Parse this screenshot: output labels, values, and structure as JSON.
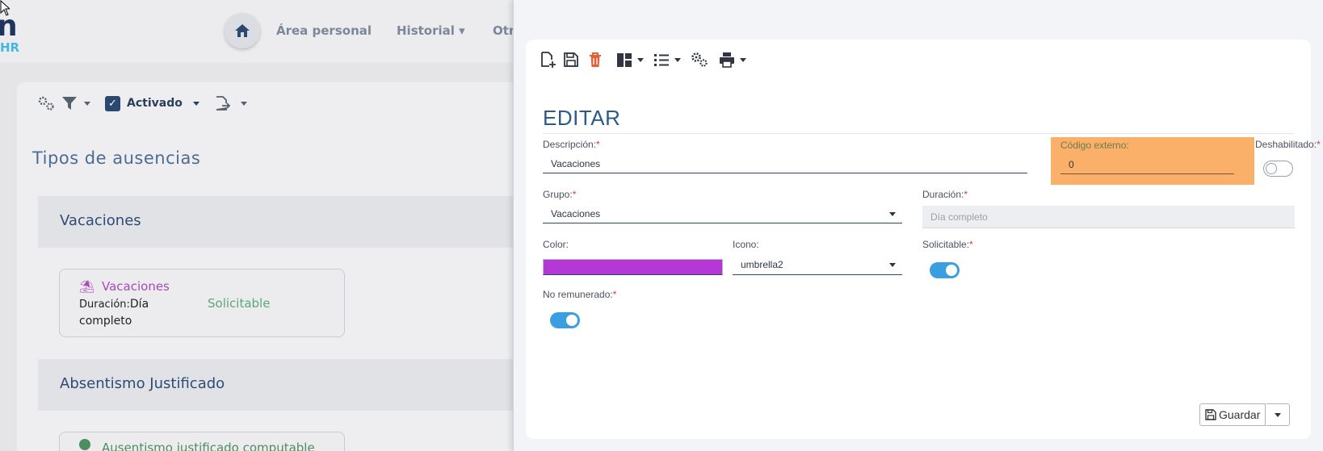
{
  "background": {
    "logo": {
      "letter": "n",
      "sub": "HR"
    },
    "nav": {
      "area_personal": "Área personal",
      "historial": "Historial ▾",
      "otros": "Otr"
    },
    "toolbar": {
      "activado": "Activado"
    },
    "page_title": "Tipos de ausencias",
    "groups": [
      {
        "title": "Vacaciones"
      },
      {
        "title": "Absentismo Justificado"
      }
    ],
    "card": {
      "name": "Vacaciones",
      "duration_label": "Duración:",
      "duration_value": "Día",
      "duration_value2": "completo",
      "status": "Solicitable"
    },
    "card2": {
      "name": "Ausentismo justificado computable"
    }
  },
  "panel": {
    "title": "EDITAR",
    "fields": {
      "descripcion": {
        "label": "Descripción:",
        "value": "Vacaciones"
      },
      "codigo_externo": {
        "label": "Código externo:",
        "value": "0"
      },
      "deshabilitado": {
        "label": "Deshabilitado:",
        "on": false
      },
      "grupo": {
        "label": "Grupo:",
        "value": "Vacaciones"
      },
      "duracion": {
        "label": "Duración:",
        "placeholder": "Día completo"
      },
      "color": {
        "label": "Color:",
        "value": "#b537d6"
      },
      "icono": {
        "label": "Icono:",
        "value": "umbrella2"
      },
      "solicitable": {
        "label": "Solicitable:",
        "on": true
      },
      "no_remunerado": {
        "label": "No remunerado:",
        "on": true
      }
    },
    "required_mark": "*",
    "save_label": "Guardar",
    "colors": {
      "accent": "#2c5a8a",
      "highlight": "#fbb069",
      "toggle_on": "#3a9fe0",
      "delete": "#e0603a"
    }
  }
}
